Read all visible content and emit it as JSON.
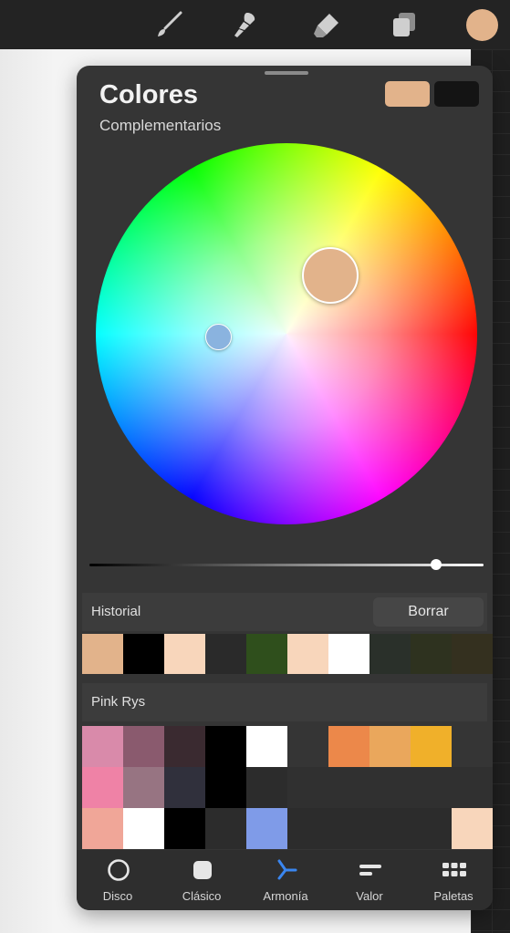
{
  "toolbar": {
    "tools": [
      {
        "name": "brush-icon"
      },
      {
        "name": "smudge-icon"
      },
      {
        "name": "eraser-icon"
      },
      {
        "name": "layers-icon"
      }
    ],
    "current_color": "#e2b38b"
  },
  "panel": {
    "title": "Colores",
    "mode_label": "Complementarios",
    "primary_color": "#e2b38b",
    "secondary_color": "#141414",
    "complement_color": "#8ab3df",
    "brightness": 0.88
  },
  "history": {
    "label": "Historial",
    "clear_label": "Borrar",
    "colors": [
      "#e2b38b",
      "#000000",
      "#f8d6bb",
      "#2a2a2a",
      "#2f4f1c",
      "#f8d6bb",
      "#ffffff",
      "#2a302a",
      "#2e321f",
      "#34301f"
    ]
  },
  "palette": {
    "label": "Pink Rys",
    "rows": [
      [
        "#d98aaa",
        "#8a5a6e",
        "#3a2a30",
        "#000000",
        "#ffffff",
        "#353535",
        "#ec884a",
        "#eaa75c",
        "#f0b02a",
        "#353535"
      ],
      [
        "#ef82a6",
        "#977482",
        "#30303c",
        "#000000",
        "#2c2c2c",
        "#303030",
        "#303030",
        "#303030",
        "#303030",
        "#303030"
      ],
      [
        "#f0a698",
        "#ffffff",
        "#000000",
        "#2c2c2c",
        "#7f9be8",
        "#2c2c2c",
        "#2c2c2c",
        "#2c2c2c",
        "#2c2c2c",
        "#f8d6bb"
      ]
    ]
  },
  "tabs": [
    {
      "label": "Disco",
      "icon": "disc-icon"
    },
    {
      "label": "Clásico",
      "icon": "square-icon"
    },
    {
      "label": "Armonía",
      "icon": "harmony-icon"
    },
    {
      "label": "Valor",
      "icon": "sliders-icon"
    },
    {
      "label": "Paletas",
      "icon": "palettes-icon"
    }
  ],
  "accent_color": "#3a86f0"
}
